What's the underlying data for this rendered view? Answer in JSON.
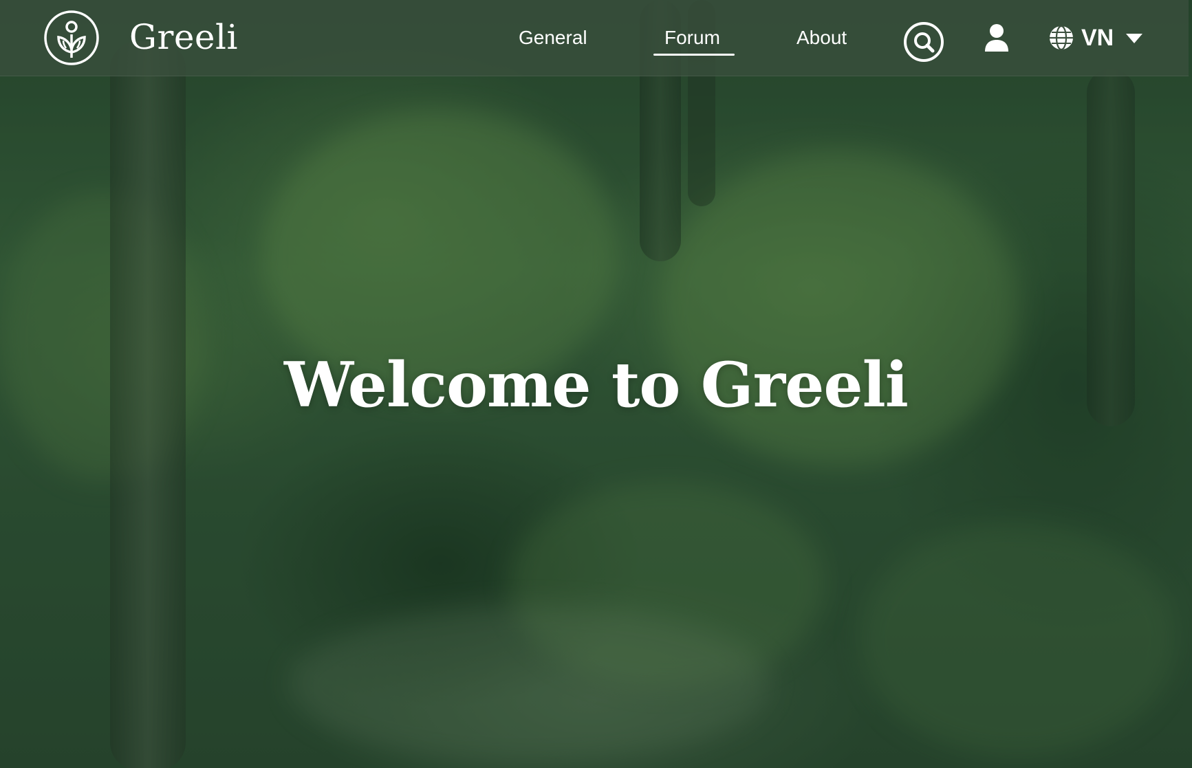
{
  "brand": {
    "name": "Greeli",
    "logo_icon": "leaf-sprout-logo"
  },
  "nav": {
    "links": [
      {
        "label": "General",
        "active": false
      },
      {
        "label": "Forum",
        "active": true
      },
      {
        "label": "About",
        "active": false
      }
    ],
    "search_icon": "search-icon",
    "account_icon": "user-icon",
    "language": {
      "code": "VN",
      "icon": "globe-icon",
      "dropdown_icon": "caret-down-icon"
    }
  },
  "hero": {
    "headline": "Welcome to Greeli",
    "background": "forest-photo"
  },
  "colors": {
    "nav_bg": "#3c503e",
    "text": "#ffffff",
    "forest_dark": "#2d4d33",
    "forest_light": "#3f6a41"
  }
}
